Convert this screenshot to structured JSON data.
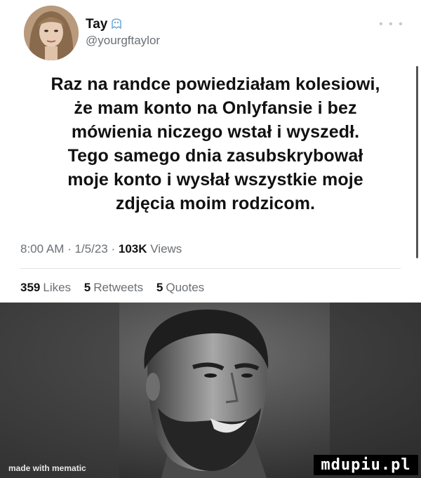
{
  "tweet": {
    "display_name": "Tay",
    "handle": "@yourgftaylor",
    "more_icon": "ellipsis-icon",
    "body_lines": [
      "Raz na randce powiedziałam kolesiowi,",
      "że mam konto na Onlyfansie i bez",
      "mówienia niczego wstał i wyszedł.",
      "Tego samego dnia zasubskrybował",
      "moje konto i wysłał wszystkie moje",
      "zdjęcia moim rodzicom."
    ],
    "time": "8:00 AM",
    "date": "1/5/23",
    "views_count": "103K",
    "views_label": "Views",
    "likes_count": "359",
    "likes_label": "Likes",
    "retweets_count": "5",
    "retweets_label": "Retweets",
    "quotes_count": "5",
    "quotes_label": "Quotes"
  },
  "image": {
    "watermark_left": "made with mematic",
    "watermark_right": "mdupiu.pl"
  },
  "colors": {
    "text": "#111111",
    "muted": "#6b7075",
    "background": "#ffffff"
  }
}
